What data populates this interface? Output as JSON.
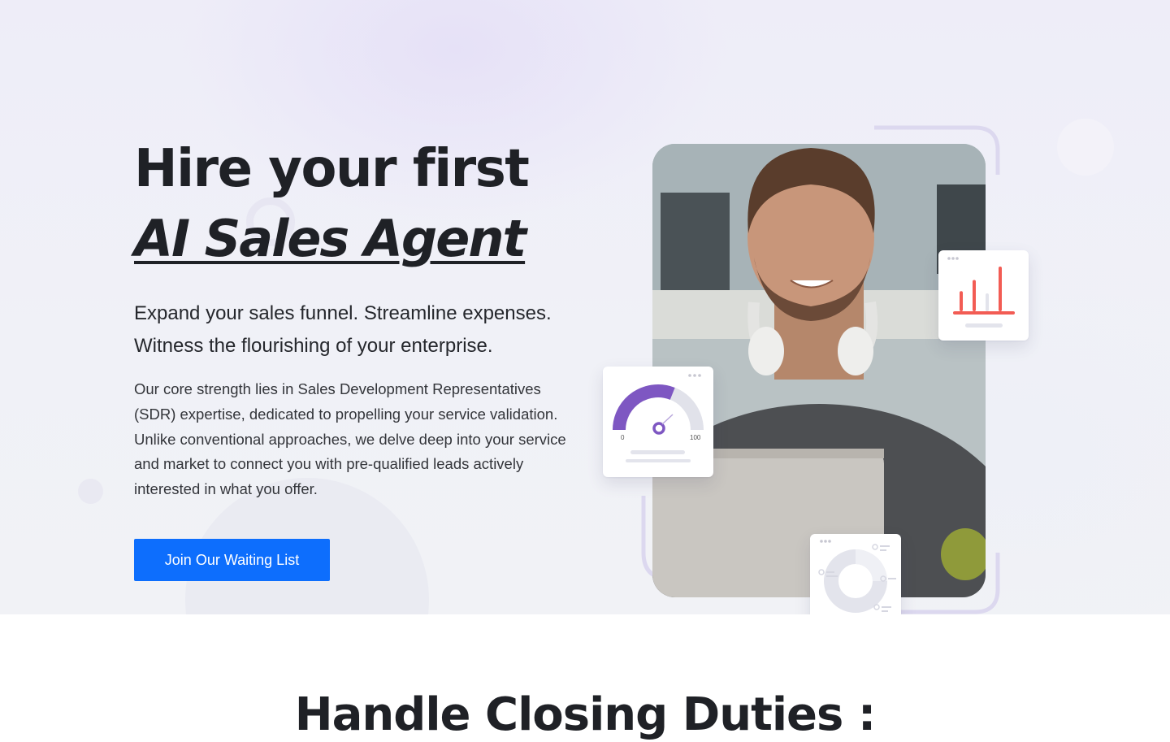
{
  "hero": {
    "title_line1": "Hire your first",
    "title_line2": "AI Sales Agent",
    "subtitle": "Expand your sales funnel. Streamline expenses. Witness the flourishing of your enterprise.",
    "description": "Our core strength lies in Sales Development Representatives (SDR) expertise, dedicated to propelling your service validation. Unlike conventional approaches, we delve deep into your service and market to connect you with pre-qualified leads actively interested in what you offer.",
    "cta_label": "Join Our Waiting List"
  },
  "widgets": {
    "gauge": {
      "min_label": "0",
      "max_label": "100",
      "level": 0.62,
      "color": "#7e57c2"
    },
    "bar_chart": {
      "color": "#f25c54",
      "values": [
        0.45,
        0.7,
        0.4,
        1.0
      ]
    },
    "donut_icon": "donut-chart-icon"
  },
  "next_section": {
    "title": "Handle Closing Duties :"
  },
  "colors": {
    "accent": "#0d6efd",
    "text": "#1f2126",
    "gauge_purple": "#7e57c2",
    "bar_red": "#f25c54"
  }
}
